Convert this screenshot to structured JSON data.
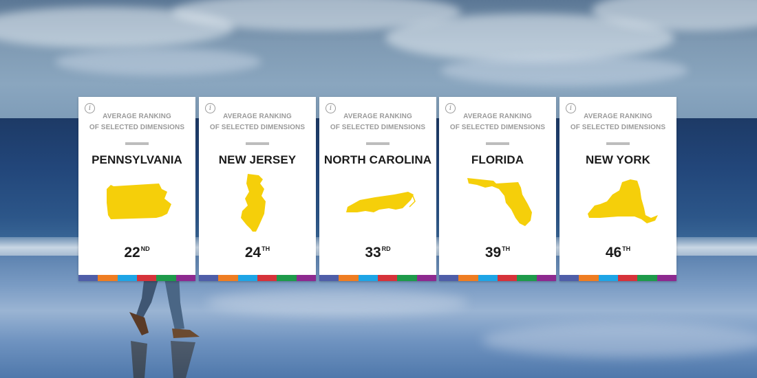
{
  "cards": [
    {
      "caption_line1": "AVERAGE RANKING",
      "caption_line2": "OF SELECTED DIMENSIONS",
      "state": "PENNSYLVANIA",
      "rank": "22",
      "suffix": "ND"
    },
    {
      "caption_line1": "AVERAGE RANKING",
      "caption_line2": "OF SELECTED DIMENSIONS",
      "state": "NEW JERSEY",
      "rank": "24",
      "suffix": "TH"
    },
    {
      "caption_line1": "AVERAGE RANKING",
      "caption_line2": "OF SELECTED DIMENSIONS",
      "state": "NORTH CAROLINA",
      "rank": "33",
      "suffix": "RD"
    },
    {
      "caption_line1": "AVERAGE RANKING",
      "caption_line2": "OF SELECTED DIMENSIONS",
      "state": "FLORIDA",
      "rank": "39",
      "suffix": "TH"
    },
    {
      "caption_line1": "AVERAGE RANKING",
      "caption_line2": "OF SELECTED DIMENSIONS",
      "state": "NEW YORK",
      "rank": "46",
      "suffix": "TH"
    }
  ],
  "colors": {
    "state_fill": "#f5cf0a",
    "dimension_bar": [
      "#4f5ea8",
      "#ef7d22",
      "#1ea5e6",
      "#d6333a",
      "#1e9a4a",
      "#8d2a8f"
    ]
  },
  "icons": {
    "info": "info-icon",
    "info_glyph": "i"
  }
}
